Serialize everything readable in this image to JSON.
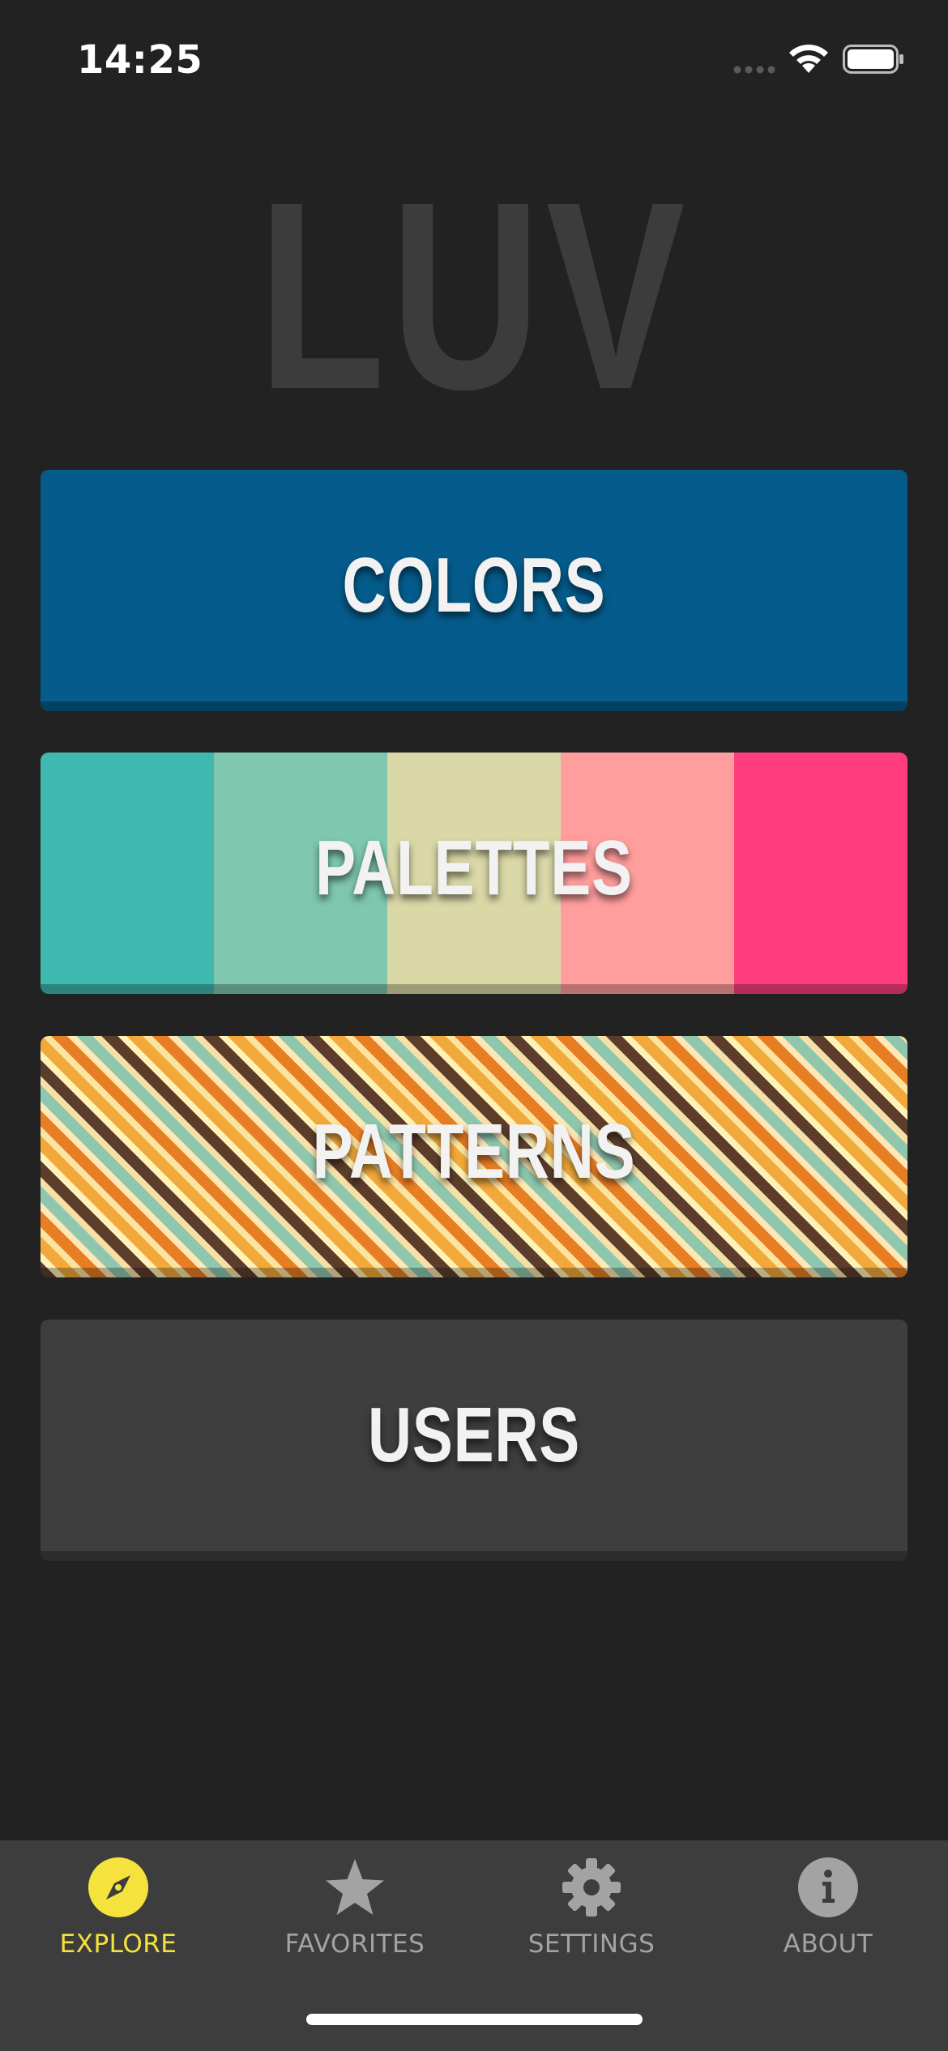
{
  "status_bar": {
    "time": "14:25"
  },
  "app": {
    "logo": "LUV"
  },
  "menu": {
    "colors": {
      "label": "COLORS",
      "color": "#055b8b"
    },
    "palettes": {
      "label": "PALETTES",
      "swatches": [
        "#3fb8af",
        "#7fc7af",
        "#dad8a7",
        "#ff9e9d",
        "#ff3d7f"
      ]
    },
    "patterns": {
      "label": "PATTERNS"
    },
    "users": {
      "label": "USERS",
      "color": "#3e3e3e"
    }
  },
  "tab_bar": {
    "active_color": "#f5e23d",
    "inactive_color": "#a3a3a3",
    "tabs": [
      {
        "label": "EXPLORE",
        "icon": "compass-icon"
      },
      {
        "label": "FAVORITES",
        "icon": "star-icon"
      },
      {
        "label": "SETTINGS",
        "icon": "gear-icon"
      },
      {
        "label": "ABOUT",
        "icon": "info-icon"
      }
    ]
  }
}
